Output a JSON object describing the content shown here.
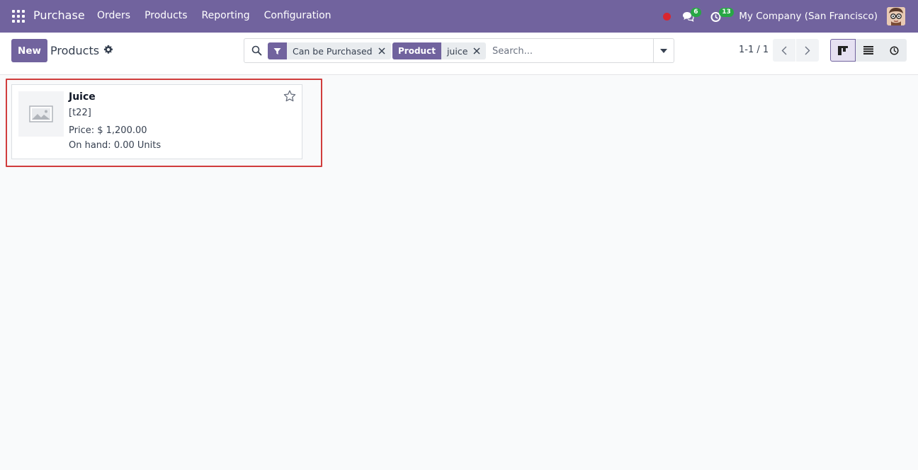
{
  "navbar": {
    "app_name": "Purchase",
    "menu": [
      "Orders",
      "Products",
      "Reporting",
      "Configuration"
    ],
    "messages_count": "6",
    "activities_count": "13",
    "company": "My Company (San Francisco)",
    "icons": {
      "apps": "apps-grid-icon",
      "recording": "red-dot-icon",
      "messages": "chat-icon",
      "activities": "clock-icon",
      "user": "avatar-icon"
    },
    "colors": {
      "bar": "#71639e",
      "badge": "#28a745",
      "recording": "#d9262f"
    }
  },
  "control_panel": {
    "new_label": "New",
    "title": "Products",
    "search": {
      "facets": [
        {
          "label": "",
          "icon": "filter-icon",
          "values": "Can be Purchased"
        },
        {
          "label": "Product",
          "values": "juice"
        }
      ],
      "placeholder": "Search..."
    },
    "pager": {
      "value": "1-1 / 1"
    },
    "views": [
      "kanban",
      "list",
      "activity"
    ],
    "active_view": "kanban"
  },
  "kanban": {
    "records": [
      {
        "name": "Juice",
        "code": "[t22]",
        "price": "Price: $ 1,200.00",
        "on_hand": "On hand: 0.00 Units",
        "image": "placeholder-image-icon",
        "favorite": false
      }
    ],
    "highlight_color": "#d03c3c"
  }
}
